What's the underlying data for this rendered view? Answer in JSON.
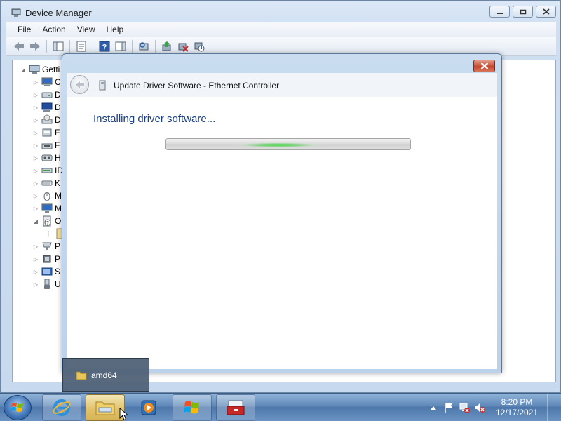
{
  "device_manager": {
    "title": "Device Manager",
    "menu": [
      "File",
      "Action",
      "View",
      "Help"
    ],
    "tree": {
      "root_label": "Getti",
      "children": [
        {
          "label": "C",
          "icon": "computer-icon",
          "expander": "▷"
        },
        {
          "label": "D",
          "icon": "disk-drive-icon",
          "expander": "▷"
        },
        {
          "label": "D",
          "icon": "display-adapter-icon",
          "expander": "▷"
        },
        {
          "label": "D",
          "icon": "dvd-drive-icon",
          "expander": "▷"
        },
        {
          "label": "F",
          "icon": "floppy-controller-icon",
          "expander": "▷"
        },
        {
          "label": "F",
          "icon": "floppy-drive-icon",
          "expander": "▷"
        },
        {
          "label": "H",
          "icon": "hid-icon",
          "expander": "▷"
        },
        {
          "label": "ID",
          "icon": "ide-controller-icon",
          "expander": "▷"
        },
        {
          "label": "K",
          "icon": "keyboard-icon",
          "expander": "▷"
        },
        {
          "label": "M",
          "icon": "mouse-icon",
          "expander": "▷"
        },
        {
          "label": "M",
          "icon": "monitor-icon",
          "expander": "▷"
        },
        {
          "label": "O",
          "icon": "other-devices-icon",
          "expander": "◢"
        },
        {
          "label": "",
          "icon": "unknown-device-icon",
          "expander": ""
        },
        {
          "label": "P",
          "icon": "port-icon",
          "expander": "▷"
        },
        {
          "label": "P",
          "icon": "processor-icon",
          "expander": "▷"
        },
        {
          "label": "S",
          "icon": "system-device-icon",
          "expander": "▷"
        },
        {
          "label": "U",
          "icon": "usb-controller-icon",
          "expander": "▷"
        }
      ]
    }
  },
  "dialog": {
    "header_title": "Update Driver Software - Ethernet Controller",
    "status_text": "Installing driver software...",
    "progress": "indeterminate"
  },
  "thumbnail_popup": {
    "label": "amd64"
  },
  "taskbar": {
    "apps": [
      {
        "name": "internet-explorer",
        "icon": "ie-icon"
      },
      {
        "name": "windows-explorer",
        "icon": "folder-icon"
      },
      {
        "name": "media-player",
        "icon": "media-player-icon"
      },
      {
        "name": "windows-flag",
        "icon": "windows-flag-icon"
      },
      {
        "name": "toolbox",
        "icon": "toolbox-icon"
      }
    ],
    "time": "8:20 PM",
    "date": "12/17/2021"
  }
}
